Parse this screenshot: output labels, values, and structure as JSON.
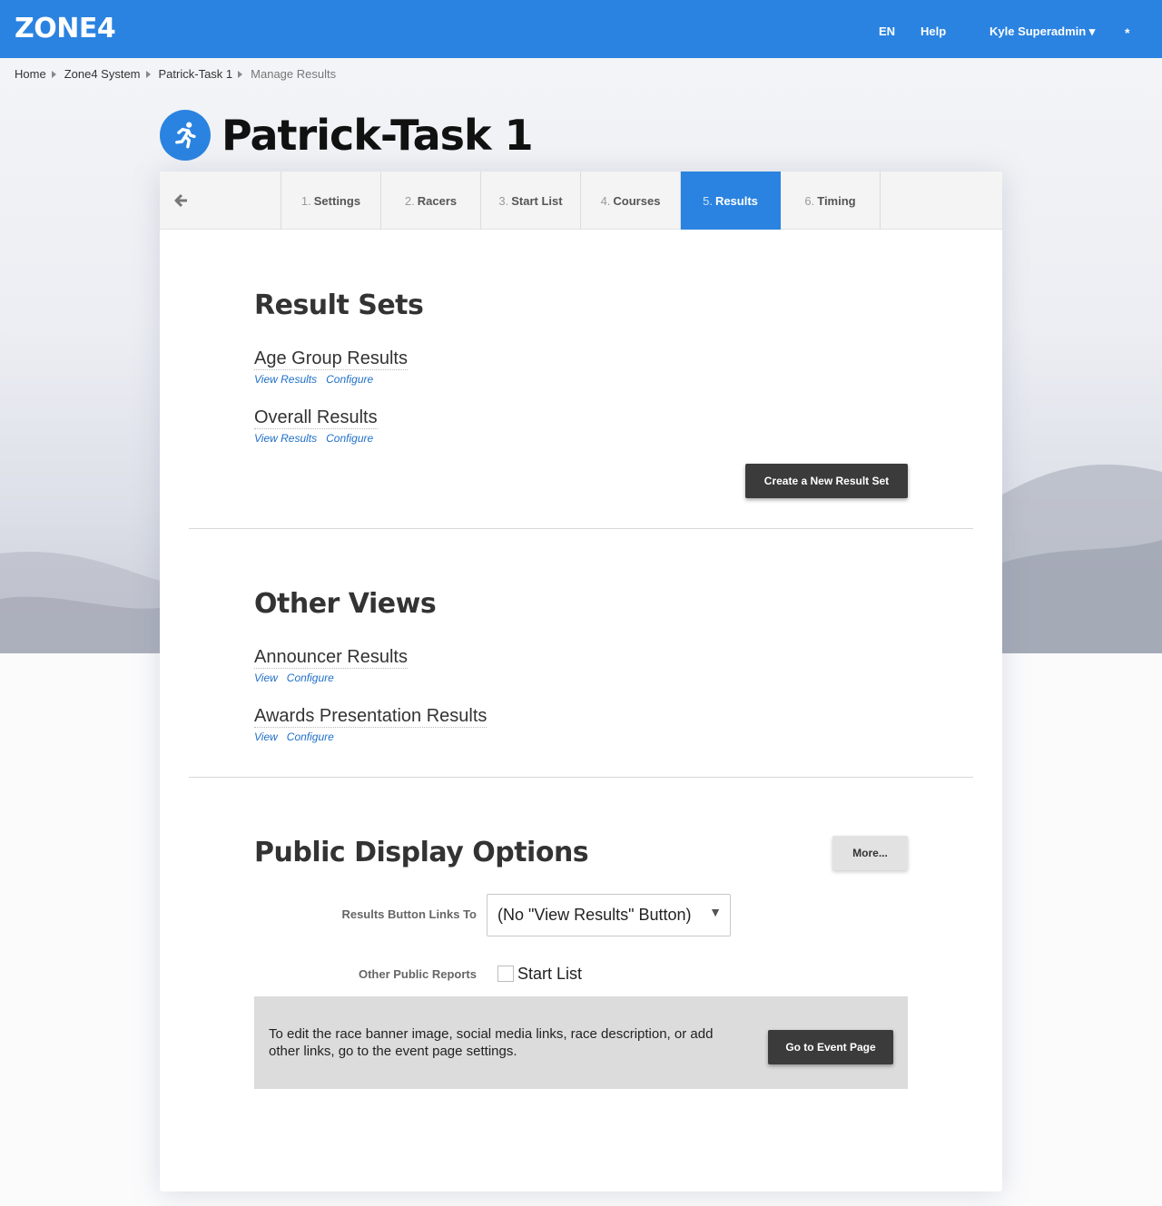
{
  "header": {
    "logo": "ZONE4",
    "language": "EN",
    "help": "Help",
    "user": "Kyle Superadmin ▾",
    "asterisk": "*"
  },
  "breadcrumb": {
    "items": [
      "Home",
      "Zone4 System",
      "Patrick-Task 1"
    ],
    "current": "Manage Results"
  },
  "event": {
    "title": "Patrick-Task 1",
    "icon": "runner-icon"
  },
  "tabs": [
    {
      "num": "1.",
      "label": "Settings"
    },
    {
      "num": "2.",
      "label": "Racers"
    },
    {
      "num": "3.",
      "label": "Start List"
    },
    {
      "num": "4.",
      "label": "Courses"
    },
    {
      "num": "5.",
      "label": "Results"
    },
    {
      "num": "6.",
      "label": "Timing"
    }
  ],
  "active_tab": "Results",
  "result_sets": {
    "heading": "Result Sets",
    "items": [
      {
        "title": "Age Group Results",
        "view": "View Results",
        "configure": "Configure"
      },
      {
        "title": "Overall Results",
        "view": "View Results",
        "configure": "Configure"
      }
    ],
    "create_button": "Create a New Result Set"
  },
  "other_views": {
    "heading": "Other Views",
    "items": [
      {
        "title": "Announcer Results",
        "view": "View",
        "configure": "Configure"
      },
      {
        "title": "Awards Presentation Results",
        "view": "View",
        "configure": "Configure"
      }
    ]
  },
  "public_display": {
    "heading": "Public Display Options",
    "more_button": "More...",
    "results_button_label": "Results Button Links To",
    "results_button_value": "(No \"View Results\" Button)",
    "other_reports_label": "Other Public Reports",
    "start_list_label": "Start List",
    "start_list_checked": false,
    "notice": "To edit the race banner image, social media links, race description, or add other links, go to the event page settings.",
    "event_page_button": "Go to Event Page"
  },
  "colors": {
    "brand_blue": "#2a83e0",
    "dark_button": "#3b3b3b",
    "link_blue": "#1f6fc9"
  }
}
